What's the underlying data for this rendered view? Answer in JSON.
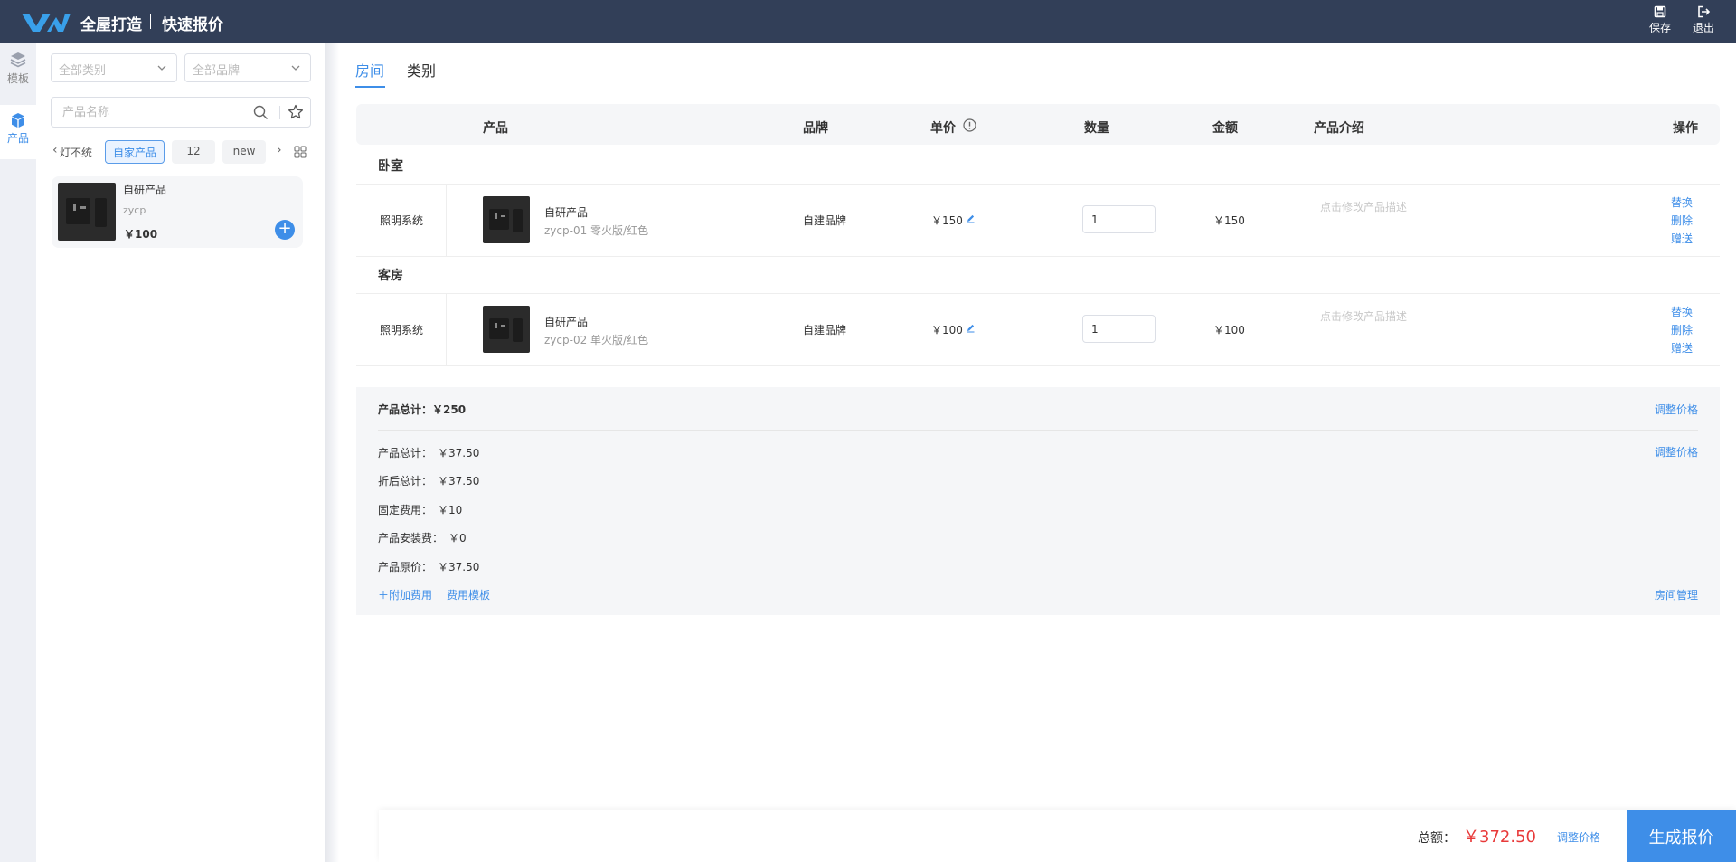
{
  "header": {
    "app_title": "全屋打造",
    "page_title": "快速报价",
    "save_label": "保存",
    "exit_label": "退出"
  },
  "rail": {
    "items": [
      {
        "label": "模板",
        "icon": "layers-icon"
      },
      {
        "label": "产品",
        "icon": "cube-icon",
        "active": true
      }
    ]
  },
  "filters": {
    "category_placeholder": "全部类别",
    "brand_placeholder": "全部品牌",
    "search_placeholder": "产品名称"
  },
  "chips": [
    {
      "label": "灯不统"
    },
    {
      "label": "自家产品",
      "active": true
    },
    {
      "label": "12"
    },
    {
      "label": "new"
    }
  ],
  "product_card": {
    "name": "自研产品",
    "code": "zycp",
    "price": "￥100"
  },
  "tabs": [
    {
      "label": "房间",
      "active": true
    },
    {
      "label": "类别"
    }
  ],
  "table": {
    "columns": {
      "product": "产品",
      "brand": "品牌",
      "unit_price": "单价",
      "quantity": "数量",
      "amount": "金额",
      "intro": "产品介绍",
      "action": "操作"
    },
    "rooms": [
      {
        "name": "卧室",
        "category": "照明系统",
        "product_name": "自研产品",
        "product_spec": "zycp-01 零火版/红色",
        "brand": "自建品牌",
        "unit_price": "￥150",
        "quantity": "1",
        "amount": "￥150",
        "intro_placeholder": "点击修改产品描述",
        "actions": [
          "替换",
          "删除",
          "赠送"
        ]
      },
      {
        "name": "客房",
        "category": "照明系统",
        "product_name": "自研产品",
        "product_spec": "zycp-02 单火版/红色",
        "brand": "自建品牌",
        "unit_price": "￥100",
        "quantity": "1",
        "amount": "￥100",
        "intro_placeholder": "点击修改产品描述",
        "actions": [
          "替换",
          "删除",
          "赠送"
        ]
      }
    ]
  },
  "summary": {
    "product_total": "产品总计：￥250",
    "adjust_price": "调整价格",
    "rows": [
      {
        "label": "产品总计：",
        "value": "￥37.50"
      },
      {
        "label": "折后总计：",
        "value": "￥37.50"
      },
      {
        "label": "固定费用：",
        "value": "￥10"
      },
      {
        "label": "产品安装费：",
        "value": "￥0"
      },
      {
        "label": "产品原价：",
        "value": "￥37.50"
      }
    ],
    "add_fee": "＋附加费用",
    "fee_template": "费用模板",
    "room_manage": "房间管理"
  },
  "footer": {
    "total_label": "总额：",
    "total_value": "￥372.50",
    "adjust_price": "调整价格",
    "generate_label": "生成报价"
  },
  "colors": {
    "topbar": "#323f58",
    "accent": "#3e8ee8",
    "total": "#e83a3a"
  }
}
